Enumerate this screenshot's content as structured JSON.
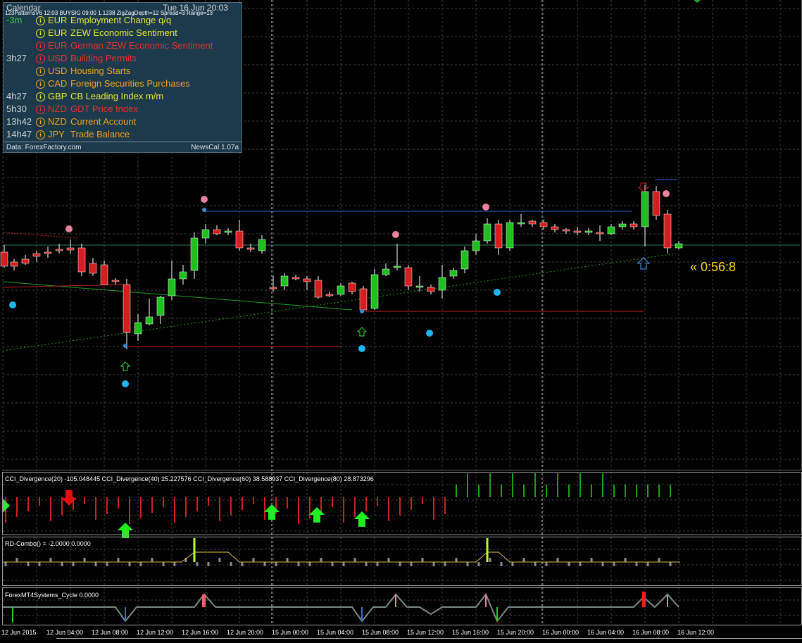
{
  "colors": {
    "grid": "#3b3b3b",
    "bull": "#1fbf1f",
    "bear": "#d31f1f",
    "wick": "#ffffff",
    "calendar_bg": "#1c3a4c",
    "high_impact": "#e8322a",
    "medium_impact": "#f0a020",
    "low_impact": "#e6e633",
    "timer": "#ffd400",
    "dot_blue": "#1fb2f0",
    "dot_pink": "#e8829a"
  },
  "calendar": {
    "title": "Calendar",
    "date": "Tue 16 Jun 20:03",
    "indicator_line": "123PatternsV6  12:03  BUYSIG  09:00  1.1238  ZigZagDepth=12  Spread=3  Range=13",
    "events": [
      {
        "time": "-3m",
        "currency": "EUR",
        "event": "Employment Change q/q",
        "impact": "low"
      },
      {
        "time": "",
        "currency": "EUR",
        "event": "ZEW Economic Sentiment",
        "impact": "low"
      },
      {
        "time": "",
        "currency": "EUR",
        "event": "German ZEW Economic Sentiment",
        "impact": "high"
      },
      {
        "time": "3h27",
        "currency": "USD",
        "event": "Building Permits",
        "impact": "high"
      },
      {
        "time": "",
        "currency": "USD",
        "event": "Housing Starts",
        "impact": "medium"
      },
      {
        "time": "",
        "currency": "CAD",
        "event": "Foreign Securities Purchases",
        "impact": "medium"
      },
      {
        "time": "4h27",
        "currency": "GBP",
        "event": "CB Leading Index m/m",
        "impact": "low"
      },
      {
        "time": "5h30",
        "currency": "NZD",
        "event": "GDT Price Index",
        "impact": "high"
      },
      {
        "time": "13h42",
        "currency": "NZD",
        "event": "Current Account",
        "impact": "medium"
      },
      {
        "time": "14h47",
        "currency": "JPY",
        "event": "Trade Balance",
        "impact": "medium"
      }
    ],
    "footer_left": "Data: ForexFactory.com",
    "footer_right": "NewsCal 1.07a"
  },
  "timer": "« 0:56:8",
  "panes": {
    "cci_label": "CCI_Divergence(20) -105.048445  CCI_Divergence(40) 25.227576  CCI_Divergence(60) 38.588937  CCI_Divergence(80) 28.873296",
    "rd_label": "RD-Combo() = -2.0000 0.0000",
    "cycle_label": "ForexMT4Systems_Cycle 0.0000"
  },
  "xaxis": {
    "labels": [
      "12 Jun 2015",
      "12 Jun 04:00",
      "12 Jun 08:00",
      "12 Jun 12:00",
      "12 Jun 16:00",
      "12 Jun 20:00",
      "15 Jun 00:00",
      "15 Jun 04:00",
      "15 Jun 08:00",
      "15 Jun 12:00",
      "15 Jun 16:00",
      "15 Jun 20:00",
      "16 Jun 00:00",
      "16 Jun 04:00",
      "16 Jun 08:00",
      "16 Jun 12:00"
    ]
  }
}
